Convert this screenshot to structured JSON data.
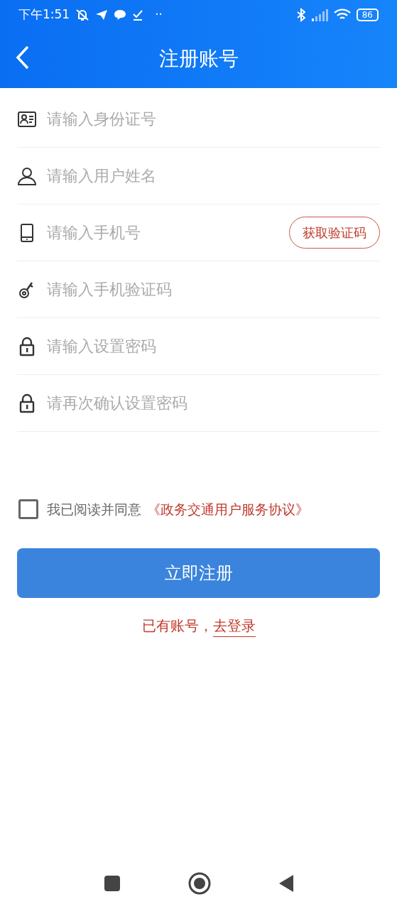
{
  "status_bar": {
    "time": "下午1:51",
    "more": "··",
    "battery": "86"
  },
  "header": {
    "title": "注册账号"
  },
  "fields": [
    {
      "kind": "text",
      "placeholder": "请输入身份证号"
    },
    {
      "kind": "text",
      "placeholder": "请输入用户姓名"
    },
    {
      "kind": "with_button",
      "placeholder": "请输入手机号",
      "button": "获取验证码"
    },
    {
      "kind": "text",
      "placeholder": "请输入手机验证码"
    },
    {
      "kind": "password",
      "placeholder": "请输入设置密码"
    },
    {
      "kind": "password",
      "placeholder": "请再次确认设置密码"
    }
  ],
  "agreement": {
    "checked": false,
    "text": "我已阅读并同意",
    "link": "《政务交通用户服务协议》"
  },
  "submit": "立即注册",
  "login": {
    "text": "已有账号，",
    "link": "去登录"
  }
}
